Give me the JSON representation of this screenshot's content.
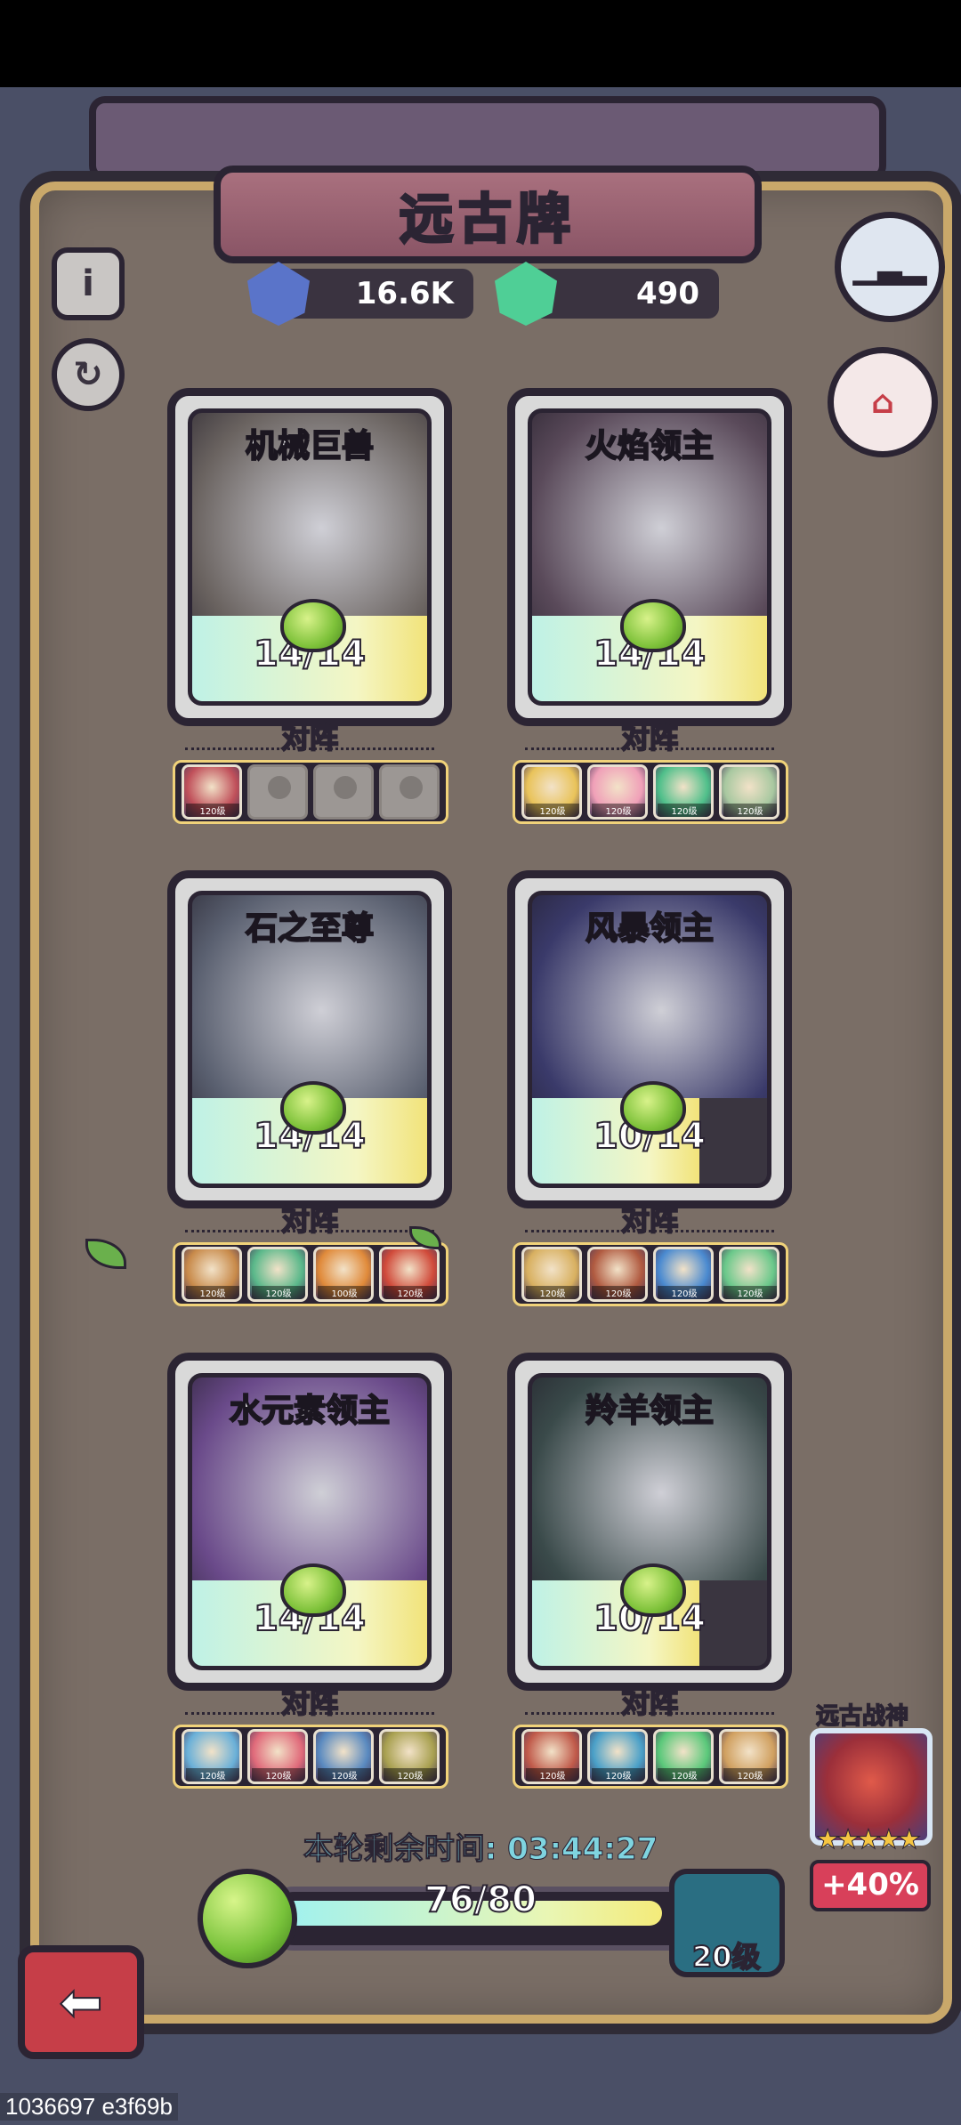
{
  "header": {
    "title": "远古牌",
    "currencies": [
      {
        "name": "blue-gem",
        "value": "16.6K",
        "color": "#5a74c9"
      },
      {
        "name": "green-gem",
        "value": "490",
        "color": "#4fcf96"
      }
    ]
  },
  "cards": [
    {
      "name": "机械巨兽",
      "progress": "14/14",
      "fill": 1.0,
      "art": "#6a6360",
      "vs": "对阵",
      "team": [
        {
          "lvl": "120级",
          "c": "#c0505a"
        },
        {
          "empty": true
        },
        {
          "empty": true
        },
        {
          "empty": true
        }
      ]
    },
    {
      "name": "火焰领主",
      "progress": "14/14",
      "fill": 1.0,
      "art": "#5a4a5a",
      "vs": "对阵",
      "team": [
        {
          "lvl": "120级",
          "c": "#e9c35a"
        },
        {
          "lvl": "120级",
          "c": "#f0a0b8"
        },
        {
          "lvl": "120级",
          "c": "#4fbf8a"
        },
        {
          "lvl": "120级",
          "c": "#a8c8a0"
        }
      ]
    },
    {
      "name": "石之至尊",
      "progress": "14/14",
      "fill": 1.0,
      "art": "#5a6070",
      "vs": "对阵",
      "team": [
        {
          "lvl": "120级",
          "c": "#c88a4a"
        },
        {
          "lvl": "120级",
          "c": "#5ab88a"
        },
        {
          "lvl": "100级",
          "c": "#e08a3a"
        },
        {
          "lvl": "120级",
          "c": "#d04a3a"
        }
      ]
    },
    {
      "name": "风暴领主",
      "progress": "10/14",
      "fill": 0.714,
      "art": "#3a3a6a",
      "vs": "对阵",
      "team": [
        {
          "lvl": "120级",
          "c": "#d8b060"
        },
        {
          "lvl": "120级",
          "c": "#b05a40"
        },
        {
          "lvl": "120级",
          "c": "#4a8ad0"
        },
        {
          "lvl": "120级",
          "c": "#6ac88a"
        }
      ]
    },
    {
      "name": "水元素领主",
      "progress": "14/14",
      "fill": 1.0,
      "art": "#6a4a8a",
      "vs": "对阵",
      "team": [
        {
          "lvl": "120级",
          "c": "#6ab0d8"
        },
        {
          "lvl": "120级",
          "c": "#e06a7a"
        },
        {
          "lvl": "120级",
          "c": "#5a8ac0"
        },
        {
          "lvl": "120级",
          "c": "#a8a050"
        }
      ]
    },
    {
      "name": "羚羊领主",
      "progress": "10/14",
      "fill": 0.714,
      "art": "#3a4a4a",
      "vs": "对阵",
      "team": [
        {
          "lvl": "120级",
          "c": "#c05a4a"
        },
        {
          "lvl": "120级",
          "c": "#4aa0c8"
        },
        {
          "lvl": "120级",
          "c": "#5ac87a"
        },
        {
          "lvl": "120级",
          "c": "#d0a060"
        }
      ]
    }
  ],
  "footer": {
    "timer_label": "本轮剩余时间: 03:44:27",
    "progress_text": "76/80",
    "progress_fill": 0.95,
    "level": "20级",
    "god_title": "远古战神",
    "stars": "★★★★★",
    "bonus": "+40%",
    "build_id": "1036697 e3f69b"
  }
}
